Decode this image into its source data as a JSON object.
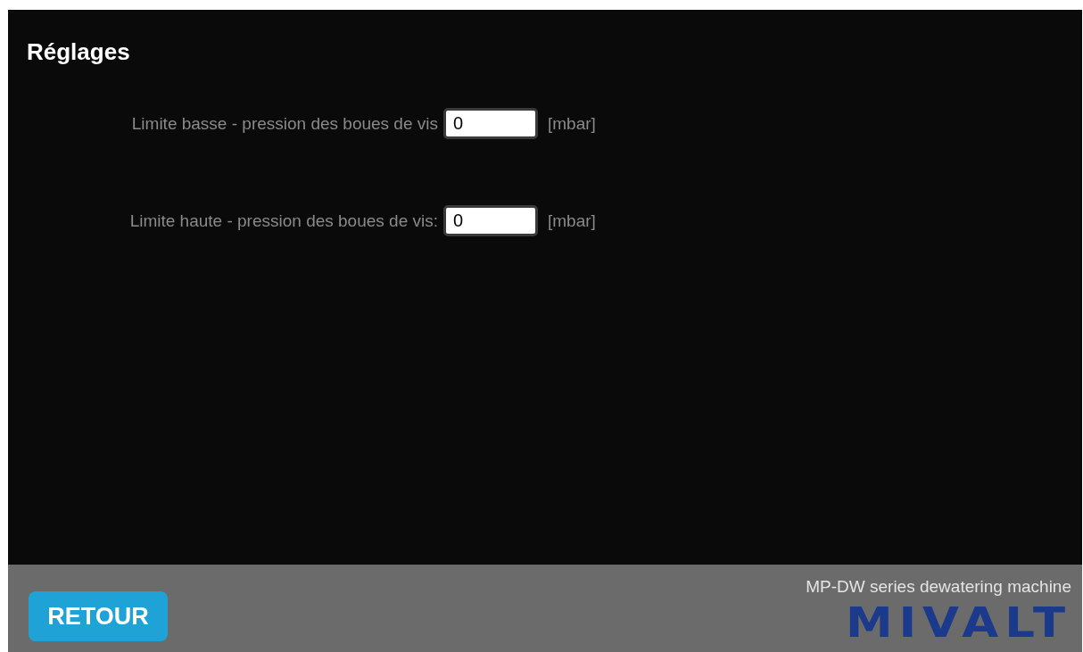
{
  "title": "Réglages",
  "fields": [
    {
      "label": "Limite basse - pression des boues de vis",
      "value": "0",
      "unit": "[mbar]"
    },
    {
      "label": "Limite haute - pression des boues de vis:",
      "value": "0",
      "unit": "[mbar]"
    }
  ],
  "footer": {
    "button": "RETOUR",
    "tagline": "MP-DW series dewatering machine",
    "logo": "MIVALT"
  }
}
